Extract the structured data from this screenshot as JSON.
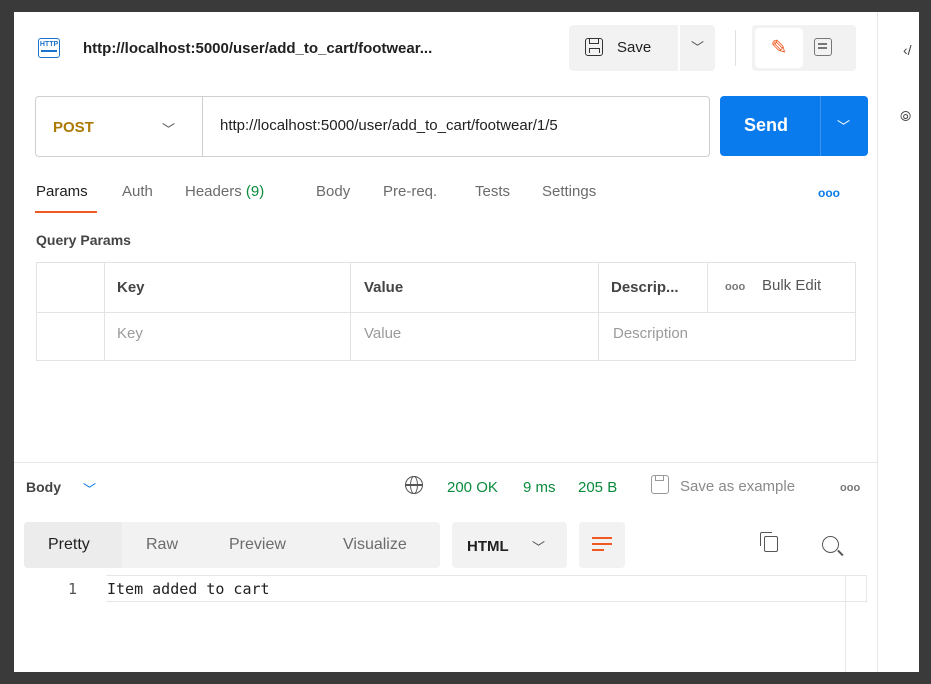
{
  "request_tab": {
    "title": "http://localhost:5000/user/add_to_cart/footwear...",
    "icon_label": "HTTP"
  },
  "toolbar": {
    "save_label": "Save"
  },
  "request": {
    "method": "POST",
    "url": "http://localhost:5000/user/add_to_cart/footwear/1/5",
    "send_label": "Send"
  },
  "request_tabs": {
    "params": "Params",
    "auth": "Auth",
    "headers": "Headers",
    "headers_count": "(9)",
    "body": "Body",
    "prereq": "Pre-req.",
    "tests": "Tests",
    "settings": "Settings",
    "more": "ooo"
  },
  "query_params": {
    "title": "Query Params",
    "columns": {
      "key": "Key",
      "value": "Value",
      "description": "Descrip...",
      "bulk_edit": "Bulk Edit",
      "dots": "ooo"
    },
    "placeholders": {
      "key": "Key",
      "value": "Value",
      "description": "Description"
    }
  },
  "response": {
    "body_label": "Body",
    "status": "200 OK",
    "time": "9 ms",
    "size": "205 B",
    "save_example": "Save as example",
    "more": "ooo",
    "formats": [
      "Pretty",
      "Raw",
      "Preview",
      "Visualize"
    ],
    "language": "HTML",
    "lines": [
      {
        "no": "1",
        "text": "Item added to cart"
      }
    ]
  },
  "colors": {
    "accent_orange": "#f05a22",
    "send_blue": "#097bed",
    "method_post": "#ad7a03",
    "status_green": "#0a8a3c"
  },
  "icons": [
    "http-icon",
    "save-icon",
    "chevron-down-icon",
    "edit-icon",
    "doc-icon",
    "globe-icon",
    "save-example-icon",
    "wrap-icon",
    "copy-icon",
    "search-icon"
  ]
}
